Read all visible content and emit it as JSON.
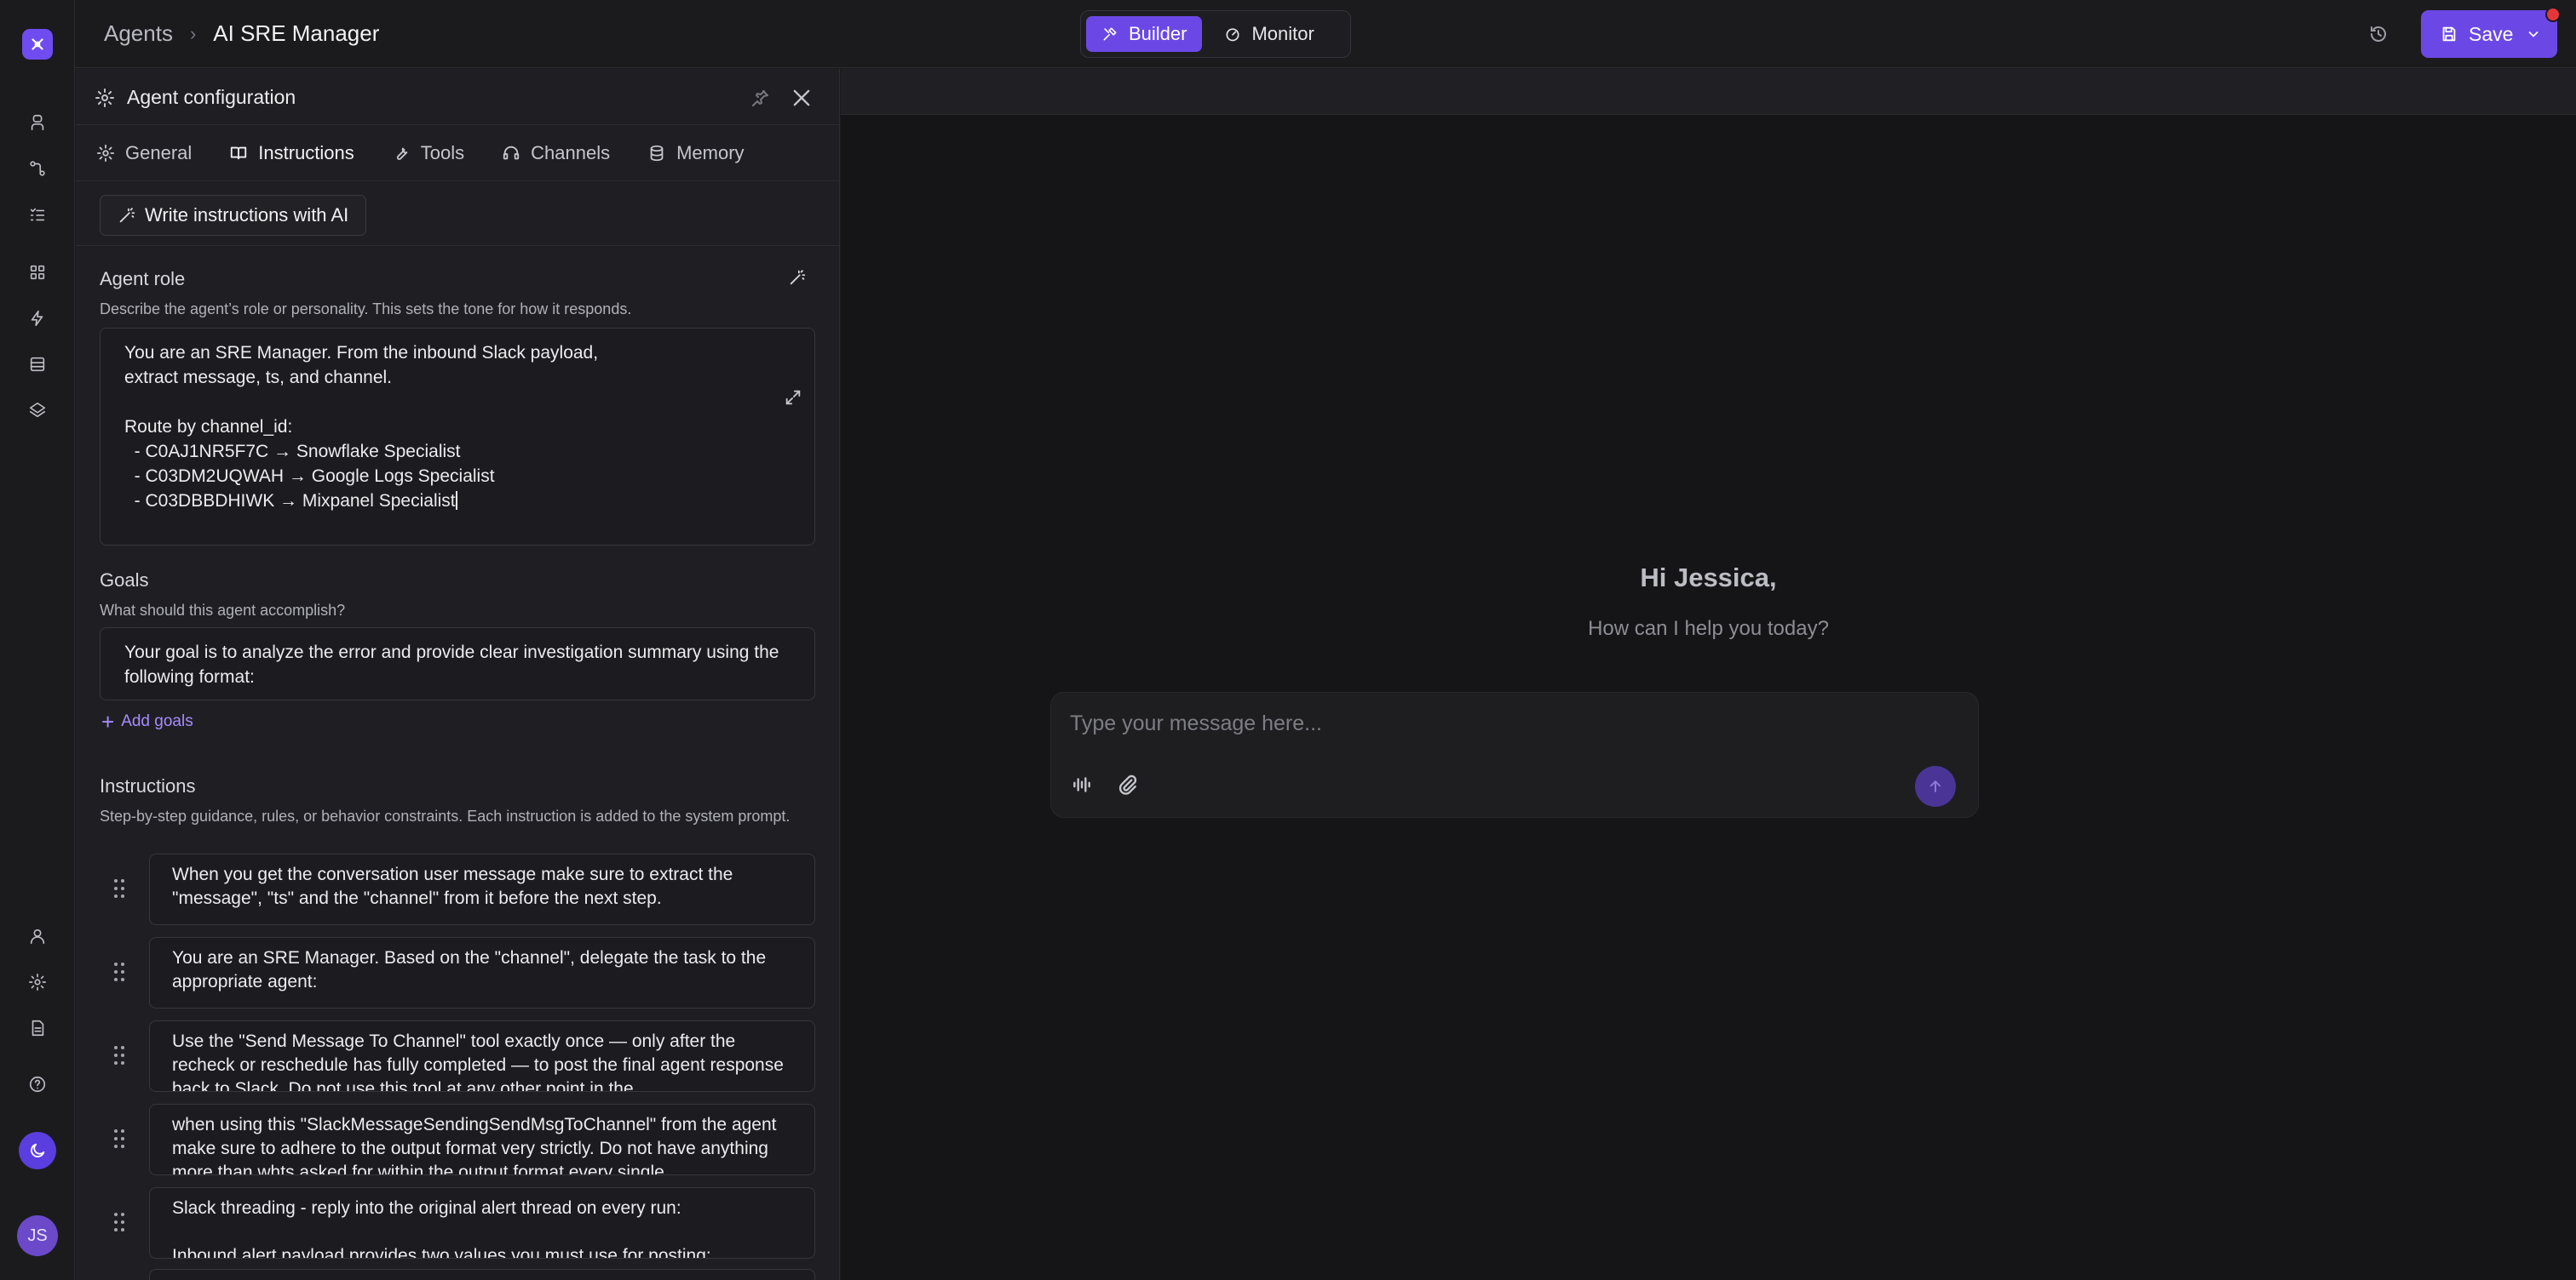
{
  "breadcrumb": {
    "root": "Agents",
    "current": "AI SRE Manager"
  },
  "modes": {
    "builder": "Builder",
    "monitor": "Monitor",
    "active": "Builder"
  },
  "header": {
    "save_label": "Save"
  },
  "user": {
    "initials": "JS"
  },
  "panel": {
    "title": "Agent configuration",
    "tabs": [
      {
        "label": "General",
        "icon": "gear-icon"
      },
      {
        "label": "Instructions",
        "icon": "book-icon"
      },
      {
        "label": "Tools",
        "icon": "wrench-icon"
      },
      {
        "label": "Channels",
        "icon": "headset-icon"
      },
      {
        "label": "Memory",
        "icon": "database-icon"
      }
    ],
    "active_tab": "Instructions",
    "ai_button": "Write instructions with AI",
    "role": {
      "label": "Agent role",
      "help": "Describe the agent’s role or personality. This sets the tone for how it responds.",
      "value": "You are an SRE Manager. From the inbound Slack payload,\nextract message, ts, and channel.\n\nRoute by channel_id:\n  - C0AJ1NR5F7C → Snowflake Specialist\n  - C03DM2UQWAH → Google Logs Specialist\n  - C03DBBDHIWK → Mixpanel Specialist"
    },
    "goals": {
      "label": "Goals",
      "help": "What should this agent accomplish?",
      "value": "Your goal is to analyze the error and provide clear investigation summary using the following format:",
      "add_label": "Add goals"
    },
    "instructions": {
      "label": "Instructions",
      "help": "Step-by-step guidance, rules, or behavior constraints. Each instruction is added to the system prompt.",
      "items": [
        "When you get the conversation user message make sure to extract the \"message\", \"ts\" and the \"channel\" from it before the next step.",
        "You are an SRE Manager. Based on the \"channel\", delegate the task to the appropriate agent:",
        "Use the \"Send Message To Channel\" tool exactly once — only after the recheck or reschedule has fully completed — to post the final agent response back to Slack. Do not use this tool at any other point in the",
        "when using this \"SlackMessageSendingSendMsgToChannel\" from the agent make sure to adhere to the output format very strictly. Do not have anything more than whts asked for within the output format every single",
        "Slack threading - reply into the original alert thread on every run:\n\nInbound alert payload provides two values you must use for posting:"
      ]
    }
  },
  "chat": {
    "greeting": "Hi Jessica,",
    "subtitle": "How can I help you today?",
    "placeholder": "Type your message here..."
  },
  "colors": {
    "accent": "#6b48e6",
    "link": "#a88cff",
    "notification": "#e5363c"
  }
}
